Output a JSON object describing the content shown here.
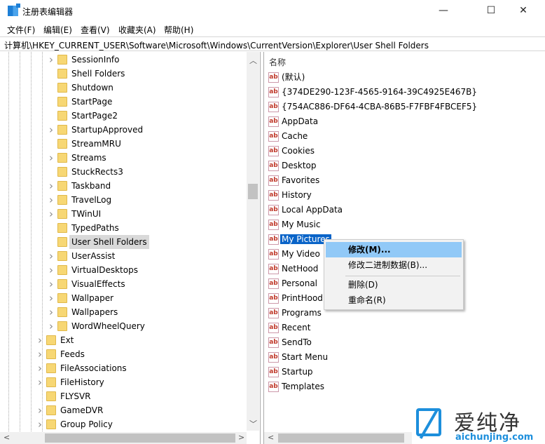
{
  "window": {
    "title": "注册表编辑器",
    "minimize": "—",
    "maximize": "☐",
    "close": "✕"
  },
  "menu": [
    "文件(F)",
    "编辑(E)",
    "查看(V)",
    "收藏夹(A)",
    "帮助(H)"
  ],
  "address": "计算机\\HKEY_CURRENT_USER\\Software\\Microsoft\\Windows\\CurrentVersion\\Explorer\\User Shell Folders",
  "tree": [
    {
      "label": "SessionInfo",
      "expandable": true,
      "level": 2
    },
    {
      "label": "Shell Folders",
      "expandable": false,
      "level": 2
    },
    {
      "label": "Shutdown",
      "expandable": false,
      "level": 2
    },
    {
      "label": "StartPage",
      "expandable": false,
      "level": 2
    },
    {
      "label": "StartPage2",
      "expandable": false,
      "level": 2
    },
    {
      "label": "StartupApproved",
      "expandable": true,
      "level": 2
    },
    {
      "label": "StreamMRU",
      "expandable": false,
      "level": 2
    },
    {
      "label": "Streams",
      "expandable": true,
      "level": 2
    },
    {
      "label": "StuckRects3",
      "expandable": false,
      "level": 2
    },
    {
      "label": "Taskband",
      "expandable": true,
      "level": 2
    },
    {
      "label": "TravelLog",
      "expandable": true,
      "level": 2
    },
    {
      "label": "TWinUI",
      "expandable": true,
      "level": 2
    },
    {
      "label": "TypedPaths",
      "expandable": false,
      "level": 2
    },
    {
      "label": "User Shell Folders",
      "expandable": false,
      "level": 2,
      "selected": true
    },
    {
      "label": "UserAssist",
      "expandable": true,
      "level": 2
    },
    {
      "label": "VirtualDesktops",
      "expandable": true,
      "level": 2
    },
    {
      "label": "VisualEffects",
      "expandable": true,
      "level": 2
    },
    {
      "label": "Wallpaper",
      "expandable": true,
      "level": 2
    },
    {
      "label": "Wallpapers",
      "expandable": true,
      "level": 2
    },
    {
      "label": "WordWheelQuery",
      "expandable": true,
      "level": 2
    },
    {
      "label": "Ext",
      "expandable": true,
      "level": 1
    },
    {
      "label": "Feeds",
      "expandable": true,
      "level": 1
    },
    {
      "label": "FileAssociations",
      "expandable": true,
      "level": 1
    },
    {
      "label": "FileHistory",
      "expandable": true,
      "level": 1
    },
    {
      "label": "FLYSVR",
      "expandable": false,
      "level": 1
    },
    {
      "label": "GameDVR",
      "expandable": true,
      "level": 1
    },
    {
      "label": "Group Policy",
      "expandable": true,
      "level": 1
    }
  ],
  "list": {
    "column": "名称",
    "icon_text": "ab",
    "items": [
      "(默认)",
      "{374DE290-123F-4565-9164-39C4925E467B}",
      "{754AC886-DF64-4CBA-86B5-F7FBF4FBCEF5}",
      "AppData",
      "Cache",
      "Cookies",
      "Desktop",
      "Favorites",
      "History",
      "Local AppData",
      "My Music",
      "My Pictures",
      "My Video",
      "NetHood",
      "Personal",
      "PrintHood",
      "Programs",
      "Recent",
      "SendTo",
      "Start Menu",
      "Startup",
      "Templates"
    ],
    "selected": "My Pictures"
  },
  "context_menu": [
    "修改(M)...",
    "修改二进制数据(B)...",
    "删除(D)",
    "重命名(R)"
  ],
  "watermark": {
    "name": "爱纯净",
    "url": "aichunjing.com"
  }
}
